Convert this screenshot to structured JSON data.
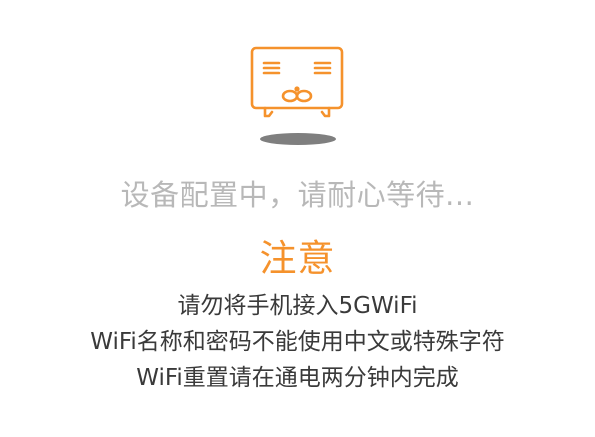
{
  "colors": {
    "accent": "#f5922c",
    "status_text": "#b8b8b8",
    "body_text": "#3a3a3a",
    "shadow": "#7f7f7f",
    "background": "#ffffff"
  },
  "illustration": {
    "icon": "router-face-icon"
  },
  "status": {
    "message": "设备配置中，请耐心等待..."
  },
  "notice": {
    "title": "注意",
    "lines": [
      "请勿将手机接入5GWiFi",
      "WiFi名称和密码不能使用中文或特殊字符",
      "WiFi重置请在通电两分钟内完成"
    ]
  }
}
